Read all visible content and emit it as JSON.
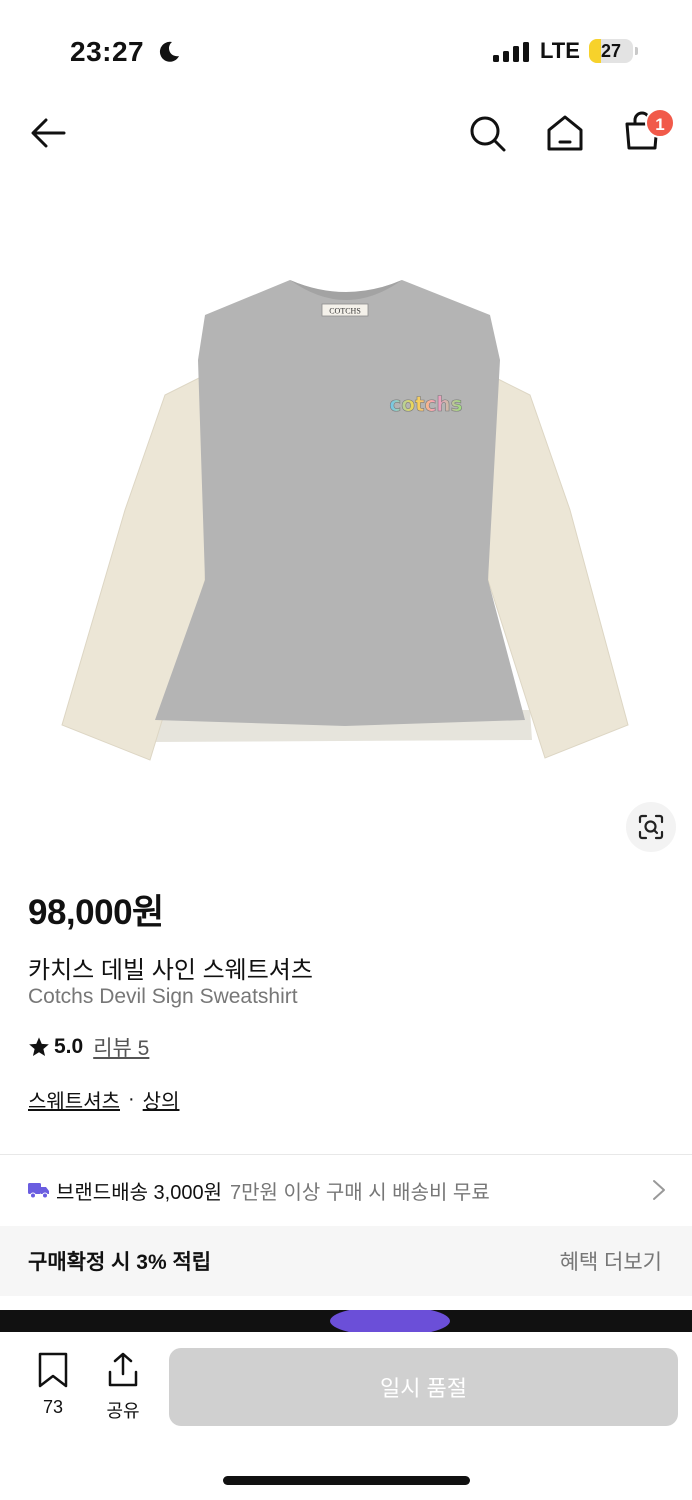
{
  "status": {
    "time": "23:27",
    "network": "LTE",
    "battery": "27",
    "battery_level": 0.27
  },
  "nav": {
    "cart_count": "1"
  },
  "product": {
    "shirt_tag": "COTCHS",
    "shirt_logo": "cotchs",
    "price": "98,000원",
    "name_ko": "카치스 데빌 사인 스웨트셔츠",
    "name_en": "Cotchs Devil Sign Sweatshirt",
    "rating": "5.0",
    "review_label": "리뷰 5",
    "category_1": "스웨트셔츠",
    "separator": "·",
    "category_2": "상의"
  },
  "shipping": {
    "brand_text": "브랜드배송 3,000원",
    "note": "7만원 이상 구매 시 배송비 무료"
  },
  "benefit": {
    "text": "구매확정 시 3% 적립",
    "more": "혜택 더보기"
  },
  "bottom": {
    "bookmark_count": "73",
    "share_label": "공유",
    "soldout_label": "일시 품절"
  },
  "colors": {
    "badge": "#f15a4a",
    "truck": "#6a5de0",
    "battery": "#f7d22b",
    "button_disabled": "#d0d0d0"
  }
}
